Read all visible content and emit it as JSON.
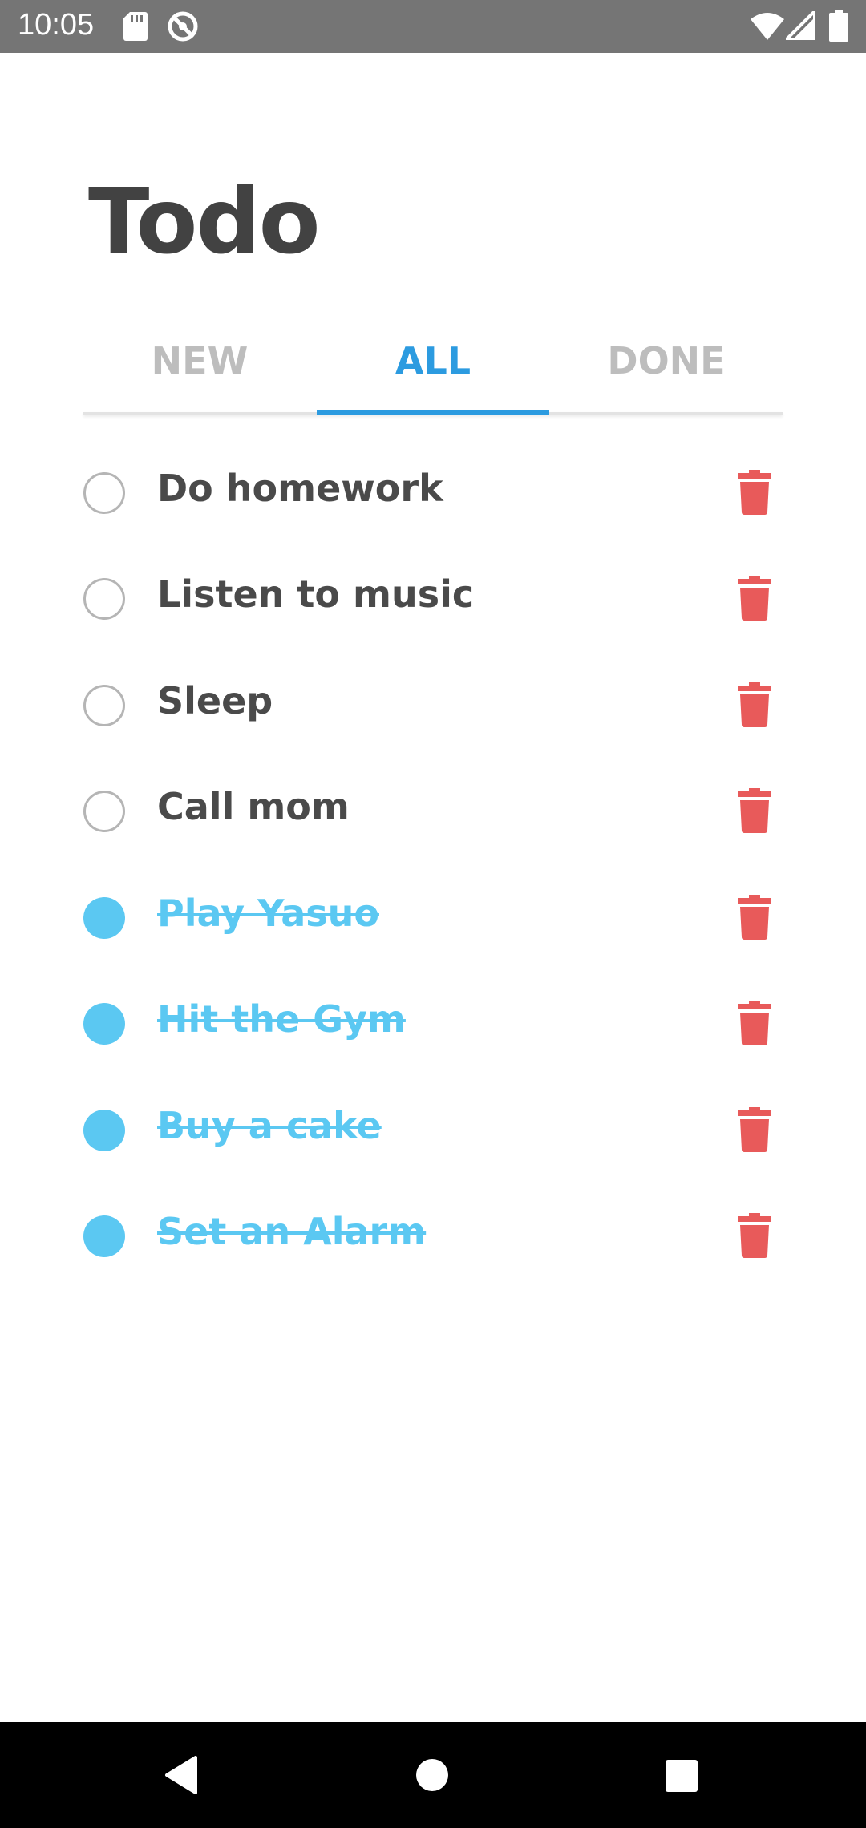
{
  "status_bar": {
    "time": "10:05",
    "left_icons": [
      "sd-card-icon",
      "do-not-disturb-icon"
    ],
    "right_icons": [
      "wifi-icon",
      "signal-icon",
      "battery-icon"
    ]
  },
  "header": {
    "title": "Todo"
  },
  "tabs": [
    {
      "label": "NEW",
      "active": false
    },
    {
      "label": "ALL",
      "active": true
    },
    {
      "label": "DONE",
      "active": false
    }
  ],
  "todos": [
    {
      "text": "Do homework",
      "done": false
    },
    {
      "text": "Listen to music",
      "done": false
    },
    {
      "text": "Sleep",
      "done": false
    },
    {
      "text": "Call mom",
      "done": false
    },
    {
      "text": "Play Yasuo",
      "done": true
    },
    {
      "text": "Hit the Gym",
      "done": true
    },
    {
      "text": "Buy a cake",
      "done": true
    },
    {
      "text": "Set an Alarm",
      "done": true
    }
  ],
  "colors": {
    "accent": "#2c9be0",
    "done": "#5bc8f2",
    "delete": "#e85a5a",
    "title": "#424242"
  },
  "nav_bar": {
    "buttons": [
      "back-icon",
      "home-icon",
      "recents-icon"
    ]
  }
}
